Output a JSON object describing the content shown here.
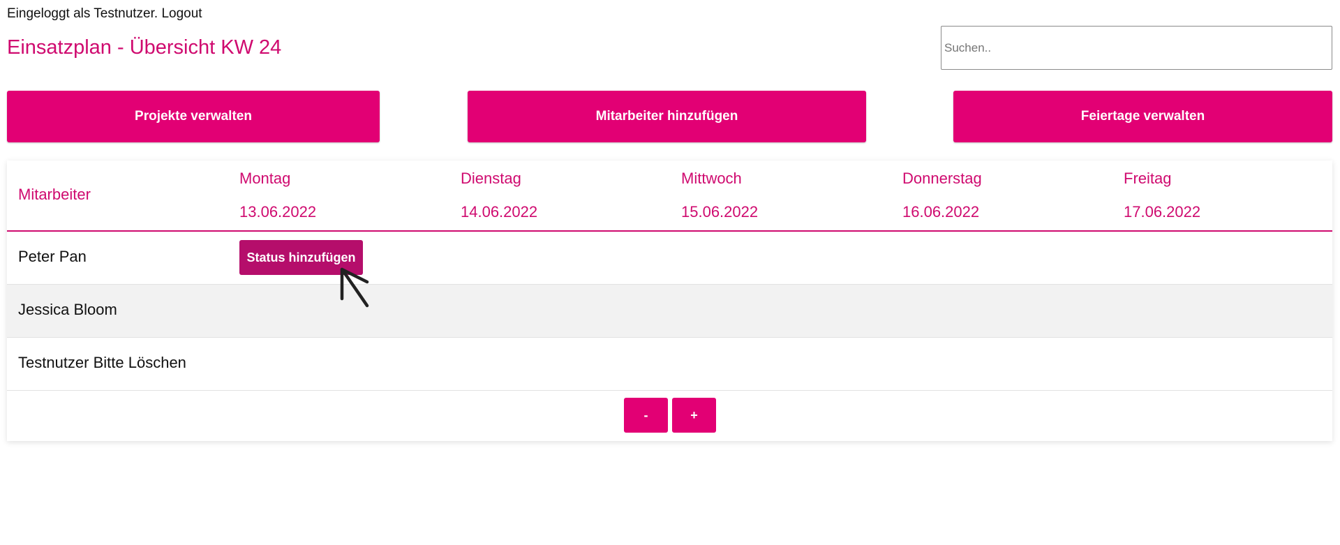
{
  "session": {
    "login_text": "Eingeloggt als Testnutzer.",
    "logout_label": "Logout"
  },
  "page": {
    "title": "Einsatzplan - Übersicht KW 24"
  },
  "search": {
    "placeholder": "Suchen.."
  },
  "actions": {
    "projects_label": "Projekte verwalten",
    "add_employee_label": "Mitarbeiter hinzufügen",
    "holidays_label": "Feiertage verwalten"
  },
  "schedule": {
    "employee_header": "Mitarbeiter",
    "days": [
      {
        "name": "Montag",
        "date": "13.06.2022"
      },
      {
        "name": "Dienstag",
        "date": "14.06.2022"
      },
      {
        "name": "Mittwoch",
        "date": "15.06.2022"
      },
      {
        "name": "Donnerstag",
        "date": "16.06.2022"
      },
      {
        "name": "Freitag",
        "date": "17.06.2022"
      }
    ],
    "employees": [
      {
        "name": "Peter Pan"
      },
      {
        "name": "Jessica Bloom"
      },
      {
        "name": "Testnutzer Bitte Löschen"
      }
    ],
    "status_button_label": "Status hinzufügen",
    "pager_minus_label": "-",
    "pager_plus_label": "+"
  },
  "colors": {
    "accent": "#e20074",
    "accent_text": "#cf0a6f",
    "status_button": "#b50e6b",
    "alt_row": "#f2f2f2"
  },
  "icons": {
    "cursor": "hand-drawn-arrow-cursor-icon"
  }
}
